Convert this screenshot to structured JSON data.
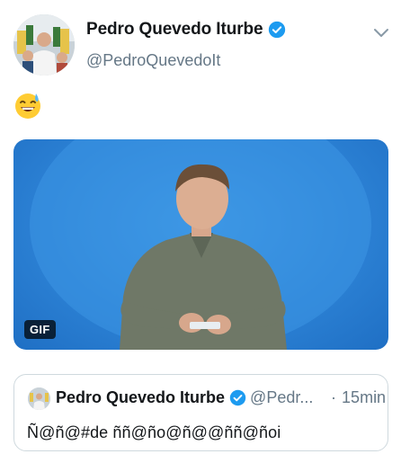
{
  "tweet": {
    "display_name": "Pedro Quevedo Iturbe",
    "handle": "@PedroQuevedoIt",
    "verified": true,
    "emoji": "😅",
    "media": {
      "badge": "GIF"
    },
    "quote": {
      "display_name": "Pedro Quevedo Iturbe",
      "handle": "@Pedr...",
      "separator": "·",
      "time": "15min",
      "text": "Ñ@ñ@#de ññ@ño@ñ@@ññ@ñoi"
    }
  },
  "icons": {
    "verified": "verified-badge-icon",
    "caret": "chevron-down-icon"
  },
  "colors": {
    "verified_blue": "#1d9bf0",
    "secondary_text": "#657786",
    "gif_background": "#2d83d6"
  }
}
